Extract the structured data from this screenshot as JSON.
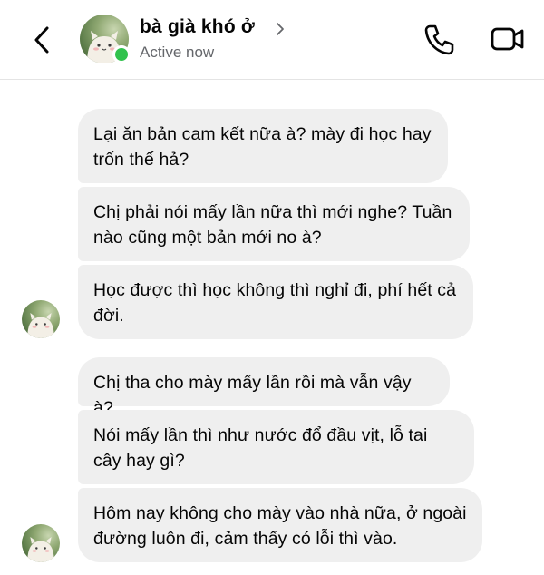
{
  "header": {
    "contact_name": "bà già khó ở",
    "status": "Active now",
    "icons": {
      "back": "chevron-left-icon",
      "name_chevron": "chevron-right-icon",
      "call": "phone-icon",
      "video": "video-camera-icon"
    },
    "online_color": "#31c24d"
  },
  "messages": [
    {
      "text": "Lại ăn bản cam kết nữa à? mày đi học hay trốn thế hả?"
    },
    {
      "text": "Chị phải nói mấy lần nữa thì mới nghe? Tuần nào cũng một bản mới no à?"
    },
    {
      "text": "Học được thì học không thì nghỉ đi, phí hết cả đời."
    },
    {
      "text": "Chị tha cho mày mấy lần rồi mà vẫn vậy à?"
    },
    {
      "text": "Nói mấy lần thì như nước đổ đầu vịt, lỗ tai cây hay gì?"
    },
    {
      "text": "Hôm nay không cho mày vào nhà nữa, ở ngoài đường luôn đi, cảm thấy có lỗi thì vào."
    }
  ],
  "colors": {
    "bubble_bg": "#efefef",
    "text": "#050505",
    "secondary_text": "#65676b"
  }
}
